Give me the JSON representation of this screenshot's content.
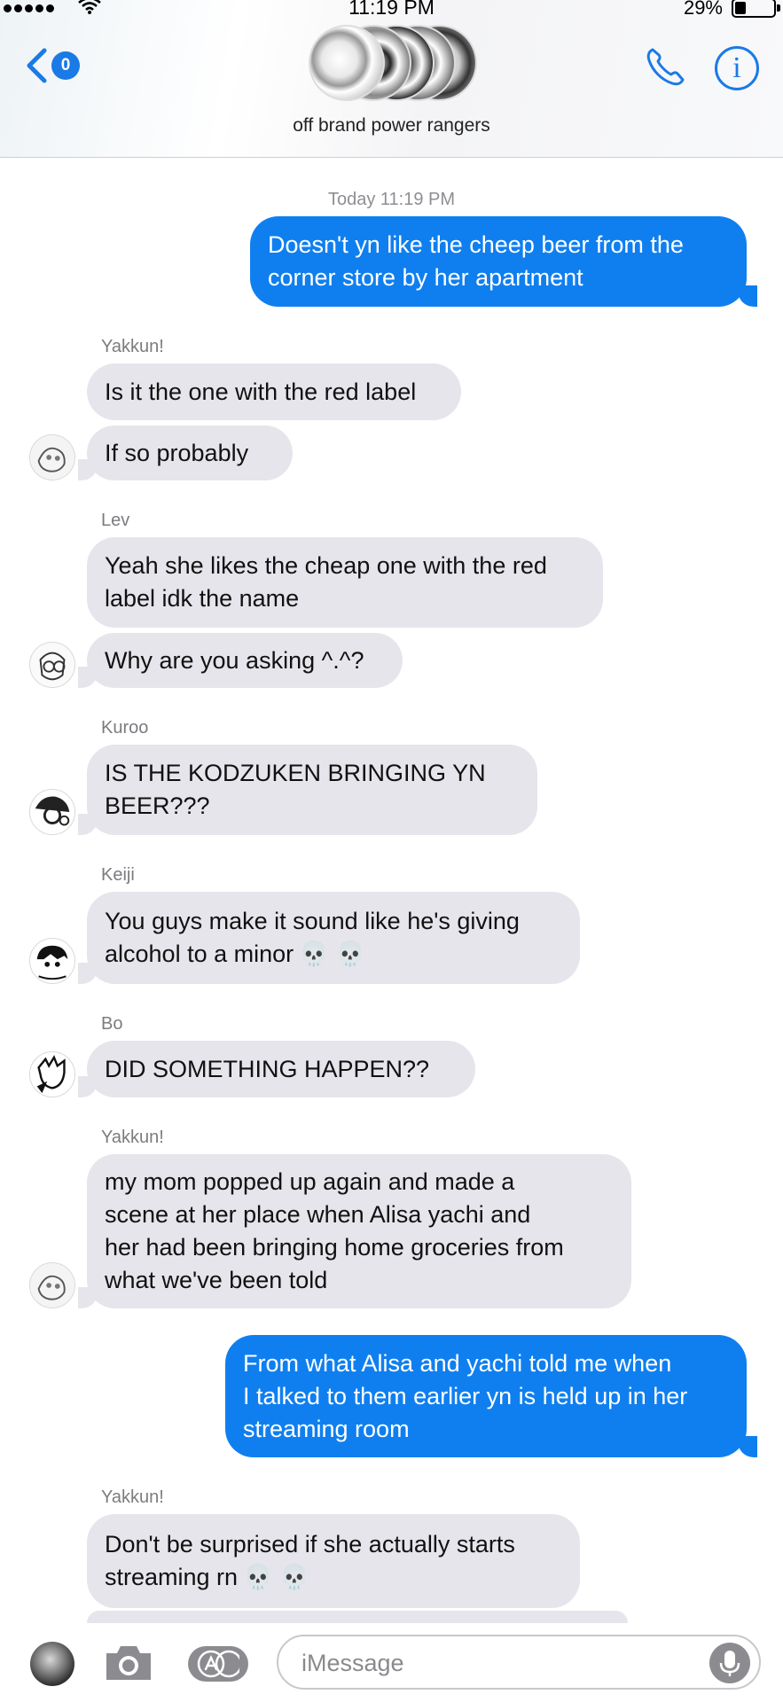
{
  "status_bar": {
    "time": "11:19 PM",
    "battery_percent": "29%",
    "battery_level": 0.29
  },
  "header": {
    "back_badge": "0",
    "group_name": "off brand power rangers"
  },
  "timestamp": "Today 11:19 PM",
  "messages": [
    {
      "direction": "out",
      "lines": [
        "Doesn't yn like the cheep beer from the",
        "corner store by her apartment"
      ]
    },
    {
      "direction": "in",
      "sender": "Yakkun!",
      "text": "Is it the one with the red label"
    },
    {
      "direction": "in",
      "text": "If so probably"
    },
    {
      "direction": "in",
      "sender": "Lev",
      "lines": [
        "Yeah she likes the cheap one with the red",
        "label idk the name"
      ]
    },
    {
      "direction": "in",
      "text": "Why are you asking ^.^?"
    },
    {
      "direction": "in",
      "sender": "Kuroo",
      "lines": [
        "IS THE KODZUKEN BRINGING YN",
        "BEER???"
      ]
    },
    {
      "direction": "in",
      "sender": "Keiji",
      "lines": [
        "You guys make it sound like he's giving",
        "alcohol to a minor"
      ],
      "emoji": "💀 💀"
    },
    {
      "direction": "in",
      "sender": "Bo",
      "text": "DID SOMETHING HAPPEN??"
    },
    {
      "direction": "in",
      "sender": "Yakkun!",
      "lines": [
        "my mom popped up again and made a",
        "scene at her place when Alisa yachi and",
        "her had been bringing home groceries from",
        "what we've been told"
      ]
    },
    {
      "direction": "out",
      "lines": [
        "From what Alisa and yachi told me when",
        "I talked to them earlier yn is held up in her",
        "streaming room"
      ]
    },
    {
      "direction": "in",
      "sender": "Yakkun!",
      "lines": [
        "Don't be surprised if she actually starts",
        "streaming rn"
      ],
      "emoji": "💀 💀"
    }
  ],
  "composer": {
    "placeholder": "iMessage"
  }
}
